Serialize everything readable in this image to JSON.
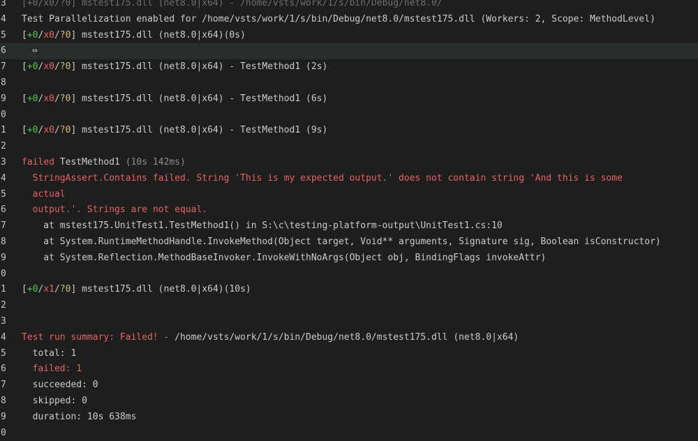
{
  "lines": [
    {
      "num": "3",
      "text": "[+0/x0/?0] mstest175.dll (net8.0|x64) - /home/vsts/work/1/s/bin/Debug/net8.0/"
    },
    {
      "num": "4",
      "text": "Test Parallelization enabled for /home/vsts/work/1/s/bin/Debug/net8.0/mstest175.dll (Workers: 2, Scope: MethodLevel)"
    },
    {
      "num": "5",
      "pass": "+0",
      "fail": "x0",
      "skip": "?0",
      "rest": " mstest175.dll (net8.0|x64)(0s)"
    },
    {
      "num": "6",
      "icon": "link-icon",
      "glyph": "⇔"
    },
    {
      "num": "7",
      "pass": "+0",
      "fail": "x0",
      "skip": "?0",
      "rest": " mstest175.dll (net8.0|x64) - TestMethod1 (2s)"
    },
    {
      "num": "8"
    },
    {
      "num": "9",
      "pass": "+0",
      "fail": "x0",
      "skip": "?0",
      "rest": " mstest175.dll (net8.0|x64) - TestMethod1 (6s)"
    },
    {
      "num": "0"
    },
    {
      "num": "1",
      "pass": "+0",
      "fail": "x0",
      "skip": "?0",
      "rest": " mstest175.dll (net8.0|x64) - TestMethod1 (9s)"
    },
    {
      "num": "2"
    },
    {
      "num": "3",
      "failed_word": "failed",
      "test_name": " TestMethod1",
      "duration": " (10s 142ms)"
    },
    {
      "num": "4",
      "error": "  StringAssert.Contains failed. String 'This is my expected output.' does not contain string 'And this is some"
    },
    {
      "num": "5",
      "error": "  actual"
    },
    {
      "num": "6",
      "error": "  output.'. Strings are not equal."
    },
    {
      "num": "7",
      "stack": "    at mstest175.UnitTest1.TestMethod1() in S:\\c\\testing-platform-output\\UnitTest1.cs:10"
    },
    {
      "num": "8",
      "stack": "    at System.RuntimeMethodHandle.InvokeMethod(Object target, Void** arguments, Signature sig, Boolean isConstructor)"
    },
    {
      "num": "9",
      "stack": "    at System.Reflection.MethodBaseInvoker.InvokeWithNoArgs(Object obj, BindingFlags invokeAttr)"
    },
    {
      "num": "0"
    },
    {
      "num": "1",
      "pass": "+0",
      "fail": "x1",
      "skip": "?0",
      "rest": " mstest175.dll (net8.0|x64)(10s)"
    },
    {
      "num": "2"
    },
    {
      "num": "3"
    },
    {
      "num": "4",
      "summary_label": "Test run summary: Failed!",
      "summary_sep": " - ",
      "summary_rest": "/home/vsts/work/1/s/bin/Debug/net8.0/mstest175.dll (net8.0|x64)"
    },
    {
      "num": "5",
      "stat": "  total: 1"
    },
    {
      "num": "6",
      "stat_red": "  failed: 1"
    },
    {
      "num": "7",
      "stat": "  succeeded: 0"
    },
    {
      "num": "8",
      "stat": "  skipped: 0"
    },
    {
      "num": "9",
      "stat": "  duration: 10s 638ms"
    },
    {
      "num": "0"
    }
  ]
}
